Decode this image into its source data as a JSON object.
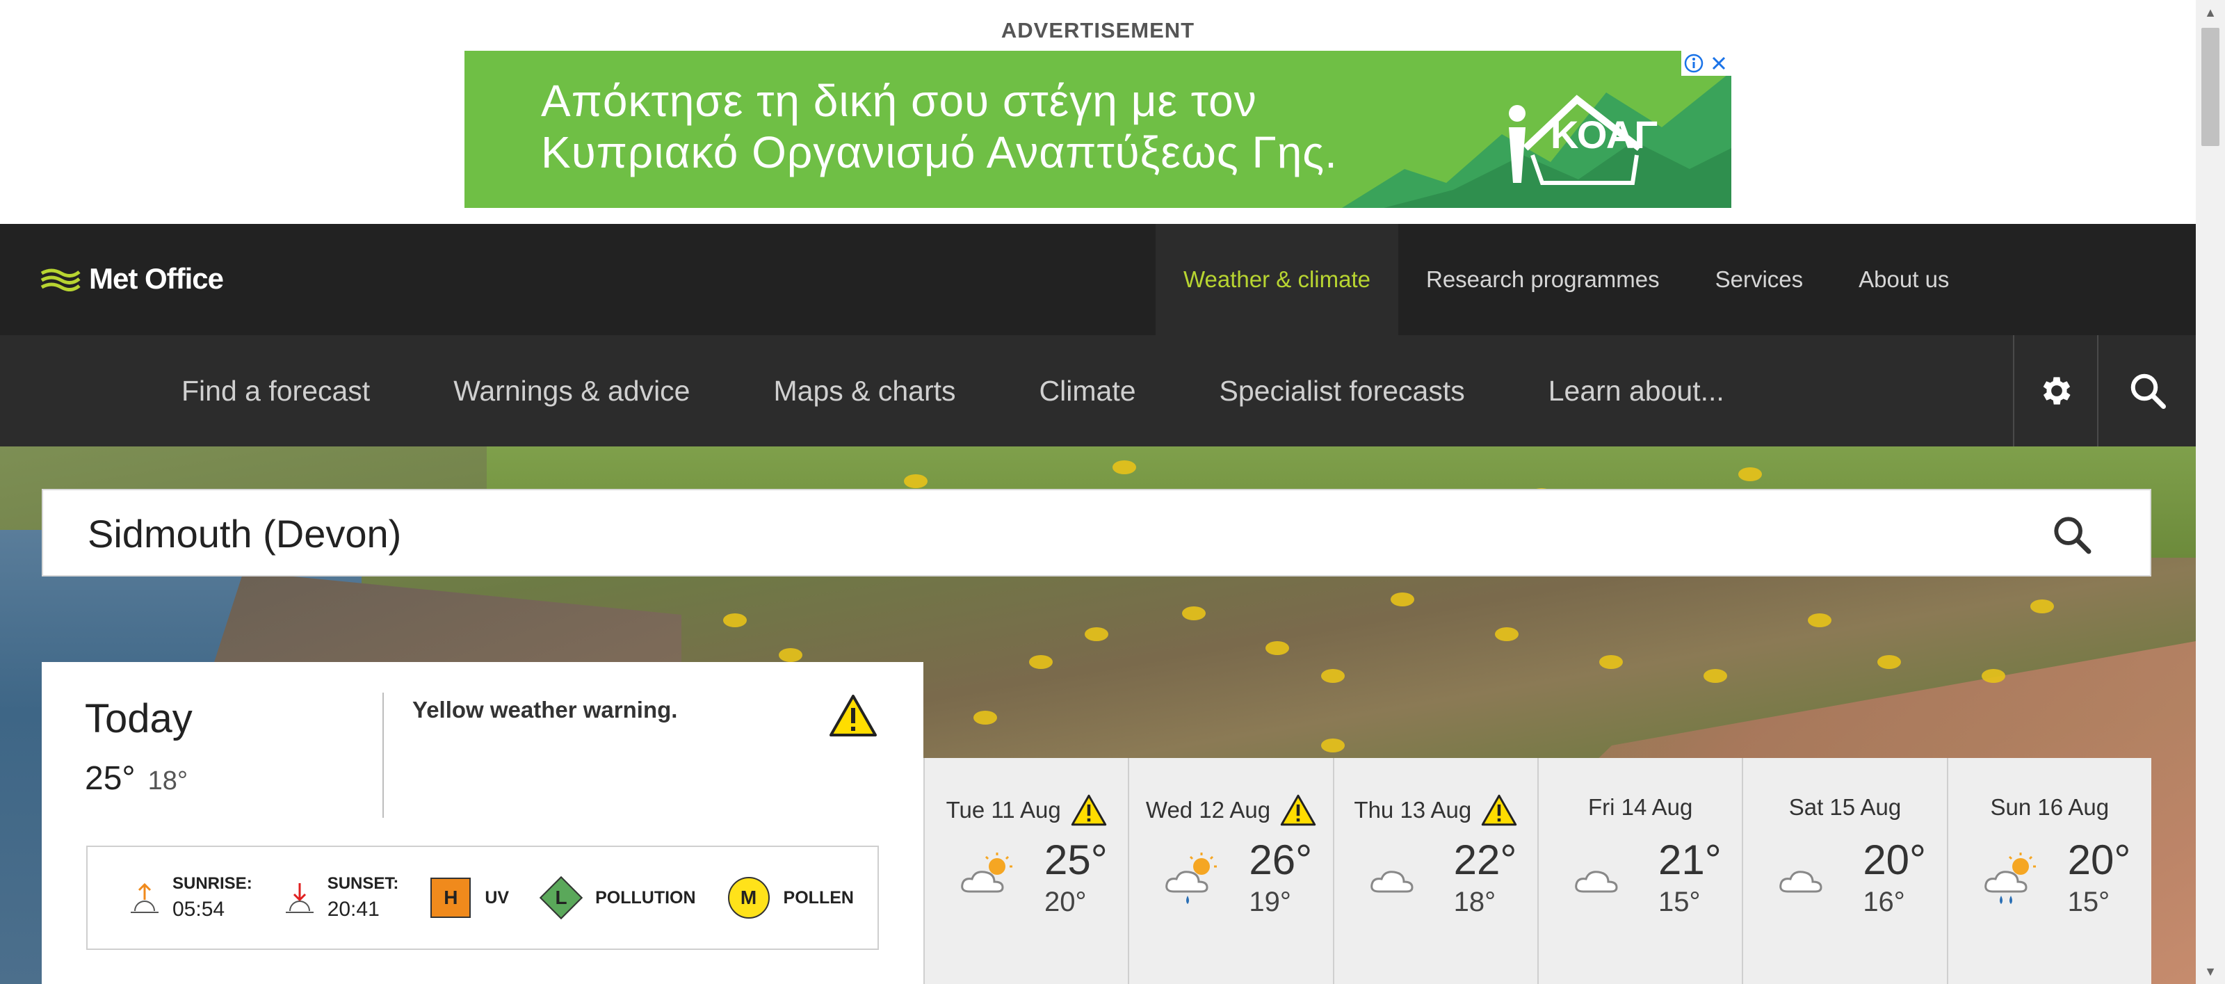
{
  "advertisement": {
    "label": "ADVERTISEMENT",
    "line1": "Απόκτησε τη δική σου στέγη με τον",
    "line2": "Κυπριακό Οργανισμό Αναπτύξεως Γης.",
    "brand": "ΚΟΑΓ",
    "color": "#6fbf45"
  },
  "header": {
    "logo_text": "Met Office",
    "nav": [
      {
        "label": "Weather & climate",
        "active": true
      },
      {
        "label": "Research programmes"
      },
      {
        "label": "Services"
      },
      {
        "label": "About us"
      }
    ],
    "accent": "#b8d531"
  },
  "subnav": {
    "items": [
      "Find a forecast",
      "Warnings & advice",
      "Maps & charts",
      "Climate",
      "Specialist forecasts",
      "Learn about..."
    ],
    "settings_icon": "gear-icon",
    "search_icon": "search-icon"
  },
  "search": {
    "value": "Sidmouth (Devon)"
  },
  "today": {
    "title": "Today",
    "high": "25°",
    "low": "18°",
    "warning": "Yellow weather warning.",
    "sunrise_label": "SUNRISE:",
    "sunrise": "05:54",
    "sunset_label": "SUNSET:",
    "sunset": "20:41",
    "uv_level": "H",
    "uv_label": "UV",
    "pollution_level": "L",
    "pollution_label": "POLLUTION",
    "pollen_level": "M",
    "pollen_label": "POLLEN"
  },
  "days": [
    {
      "label": "Tue 11 Aug",
      "warning": true,
      "icon": "sunny-intervals",
      "high": "25°",
      "low": "20°"
    },
    {
      "label": "Wed 12 Aug",
      "warning": true,
      "icon": "light-shower",
      "high": "26°",
      "low": "19°"
    },
    {
      "label": "Thu 13 Aug",
      "warning": true,
      "icon": "cloudy",
      "high": "22°",
      "low": "18°"
    },
    {
      "label": "Fri 14 Aug",
      "warning": false,
      "icon": "cloudy",
      "high": "21°",
      "low": "15°"
    },
    {
      "label": "Sat 15 Aug",
      "warning": false,
      "icon": "cloudy",
      "high": "20°",
      "low": "16°"
    },
    {
      "label": "Sun 16 Aug",
      "warning": false,
      "icon": "heavy-shower",
      "high": "20°",
      "low": "15°"
    }
  ]
}
